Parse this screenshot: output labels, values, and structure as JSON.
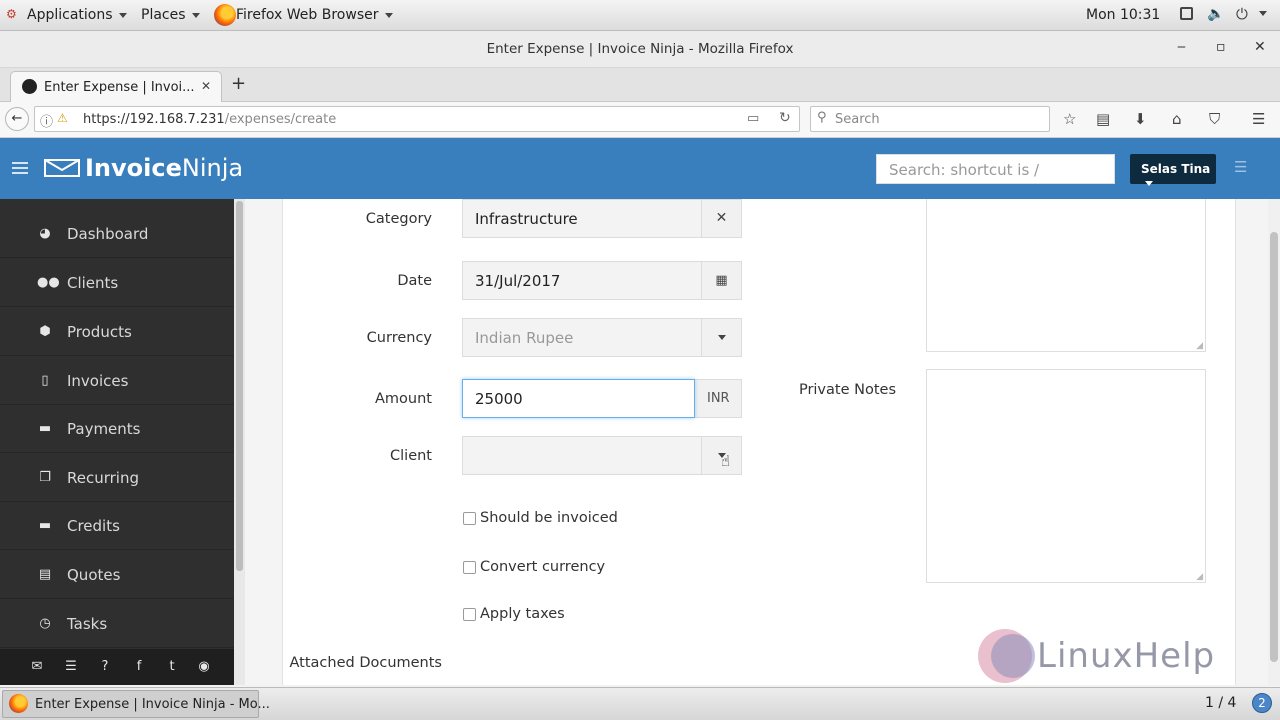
{
  "gnome_bar": {
    "applications": "Applications",
    "places": "Places",
    "browser_menu": "Firefox Web Browser",
    "clock": "Mon 10:31"
  },
  "window": {
    "title": "Enter Expense | Invoice Ninja - Mozilla Firefox",
    "minimize": "‒",
    "maximize": "▫",
    "close": "✕"
  },
  "tabs": [
    {
      "label": "Enter Expense | Invoi...",
      "close": "✕"
    }
  ],
  "new_tab": "+",
  "navbar": {
    "url_host": "https://192.168.7.231",
    "url_path": "/expenses/create",
    "search_placeholder": "Search"
  },
  "app": {
    "brand_bold": "Invoice",
    "brand_light": "Ninja",
    "search_placeholder": "Search: shortcut is /",
    "user_name": "Selas Tina"
  },
  "sidebar": {
    "items": [
      {
        "label": "Dashboard",
        "icon": "dashboard-icon"
      },
      {
        "label": "Clients",
        "icon": "users-icon"
      },
      {
        "label": "Products",
        "icon": "cube-icon"
      },
      {
        "label": "Invoices",
        "icon": "file-pdf-icon"
      },
      {
        "label": "Payments",
        "icon": "credit-card-icon"
      },
      {
        "label": "Recurring",
        "icon": "files-icon"
      },
      {
        "label": "Credits",
        "icon": "credit-card-icon"
      },
      {
        "label": "Quotes",
        "icon": "file-text-icon"
      },
      {
        "label": "Tasks",
        "icon": "clock-icon"
      }
    ],
    "footer_icons": [
      "envelope-icon",
      "list-icon",
      "question-icon",
      "facebook-icon",
      "twitter-icon",
      "github-icon"
    ]
  },
  "form": {
    "category": {
      "label": "Category",
      "value": "Infrastructure"
    },
    "date": {
      "label": "Date",
      "value": "31/Jul/2017"
    },
    "currency": {
      "label": "Currency",
      "value": "Indian Rupee"
    },
    "amount": {
      "label": "Amount",
      "value": "25000",
      "suffix": "INR"
    },
    "client": {
      "label": "Client",
      "value": ""
    },
    "checkboxes": [
      {
        "label": "Should be invoiced",
        "checked": false
      },
      {
        "label": "Convert currency",
        "checked": false
      },
      {
        "label": "Apply taxes",
        "checked": false
      }
    ],
    "attached_documents": "Attached Documents",
    "private_notes": "Private Notes"
  },
  "watermark": "LinuxHelp",
  "taskbar": {
    "window_label": "Enter Expense | Invoice Ninja - Mo...",
    "workspace": "1 / 4",
    "notifications": "2"
  }
}
